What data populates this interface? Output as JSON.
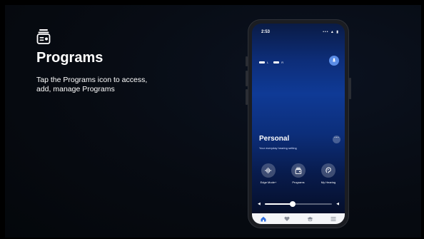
{
  "slide": {
    "title": "Programs",
    "description": "Tap the Programs icon to access, add, manage Programs",
    "heading_icon": "programs-icon"
  },
  "phone": {
    "status_time": "2:53",
    "status_icons": "••• ▲ ▮",
    "hearing_aids": {
      "left_label": "L",
      "right_label": "R"
    },
    "program": {
      "name": "Personal",
      "subtitle": "Your everyday hearing setting"
    },
    "actions": [
      {
        "label": "Edge Mode+",
        "icon": "edge-mode-icon"
      },
      {
        "label": "Programs",
        "icon": "programs-icon"
      },
      {
        "label": "My Hearing",
        "icon": "ear-icon"
      }
    ],
    "volume": {
      "level": 0.42
    },
    "tabs": [
      {
        "icon": "home-icon",
        "active": true
      },
      {
        "icon": "heart-icon",
        "active": false
      },
      {
        "icon": "graduation-cap-icon",
        "active": false
      },
      {
        "icon": "menu-icon",
        "active": false
      }
    ],
    "colors": {
      "accent": "#2f6de0",
      "tab_active": "#2f6de0",
      "tab_inactive": "#8a8f9a"
    }
  }
}
